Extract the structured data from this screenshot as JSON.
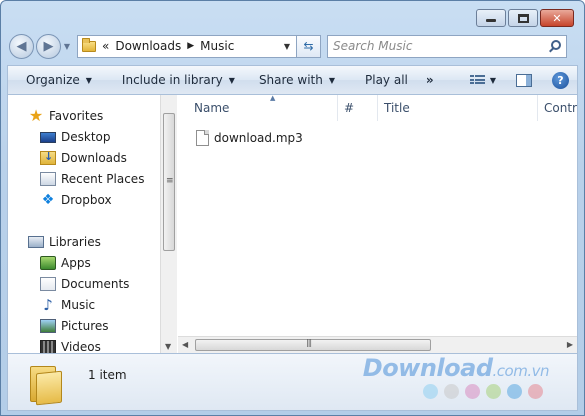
{
  "address": {
    "overflow": "«",
    "crumbs": [
      "Downloads",
      "Music"
    ]
  },
  "search": {
    "placeholder": "Search Music"
  },
  "toolbar": {
    "organize": "Organize",
    "include": "Include in library",
    "share": "Share with",
    "play_all": "Play all",
    "more": "»"
  },
  "nav": {
    "favorites": "Favorites",
    "desktop": "Desktop",
    "downloads": "Downloads",
    "recent": "Recent Places",
    "dropbox": "Dropbox",
    "libraries": "Libraries",
    "apps": "Apps",
    "documents": "Documents",
    "music": "Music",
    "pictures": "Pictures",
    "videos": "Videos"
  },
  "columns": {
    "name": "Name",
    "number": "#",
    "title": "Title",
    "contrib": "Contrib"
  },
  "files": [
    {
      "name": "download.mp3"
    }
  ],
  "status": {
    "item_count": "1 item"
  },
  "watermark": {
    "brand": "Download",
    "suffix": ".com.vn"
  },
  "colors": {
    "dots": [
      "#8fd0f0",
      "#c9c9c9",
      "#d98cc0",
      "#a8d27a",
      "#5aa8e0",
      "#e5878f"
    ]
  }
}
